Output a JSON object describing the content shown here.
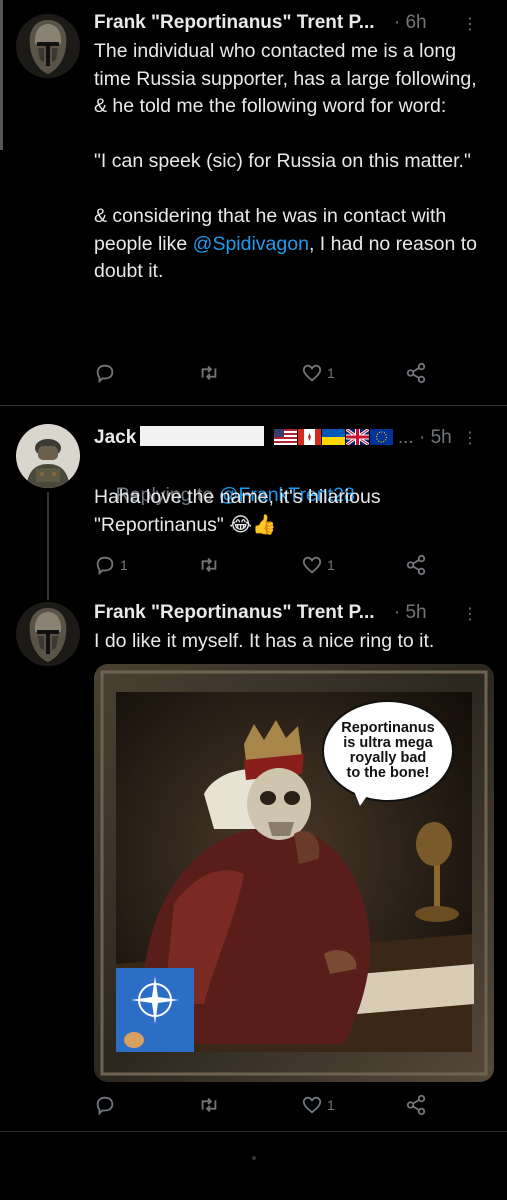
{
  "tweets": [
    {
      "author": "Frank \"Reportinanus\" Trent P...",
      "time": "· 6h",
      "more": "⋮",
      "text_before": "The individual who contacted me is a long time Russia supporter, has a large following, & he told me the following word for word:\n\n\"I can speek (sic) for Russia on this matter.\"\n\n& considering that he was in contact with people like ",
      "mention": "@Spidivagon",
      "text_after": ", I had no reason to doubt it.",
      "replies": "",
      "retweets": "",
      "likes": "1"
    },
    {
      "author": "Jack",
      "flags_suffix": "...",
      "time": "· 5h",
      "more": "⋮",
      "replying_prefix": "Replying to ",
      "replying_to": "@FrankTrent28",
      "text": "Haha love the name, it's hilarious \"Reportinanus\" 😂👍",
      "replies": "1",
      "retweets": "",
      "likes": "1"
    },
    {
      "author": "Frank \"Reportinanus\" Trent P...",
      "time": "· 5h",
      "more": "⋮",
      "text": "I do like it myself. It has a nice ring to it.",
      "image_caption": "Reportinanus\nis ultra mega\nroyally bad\nto the bone!",
      "replies": "",
      "retweets": "",
      "likes": "1"
    }
  ],
  "colors": {
    "background": "#000000",
    "text": "#e7e9ea",
    "muted": "#71767b",
    "link": "#1d9bf0",
    "divider": "#2f3336"
  },
  "icons": [
    "reply-icon",
    "retweet-icon",
    "like-icon",
    "share-icon",
    "more-icon"
  ]
}
